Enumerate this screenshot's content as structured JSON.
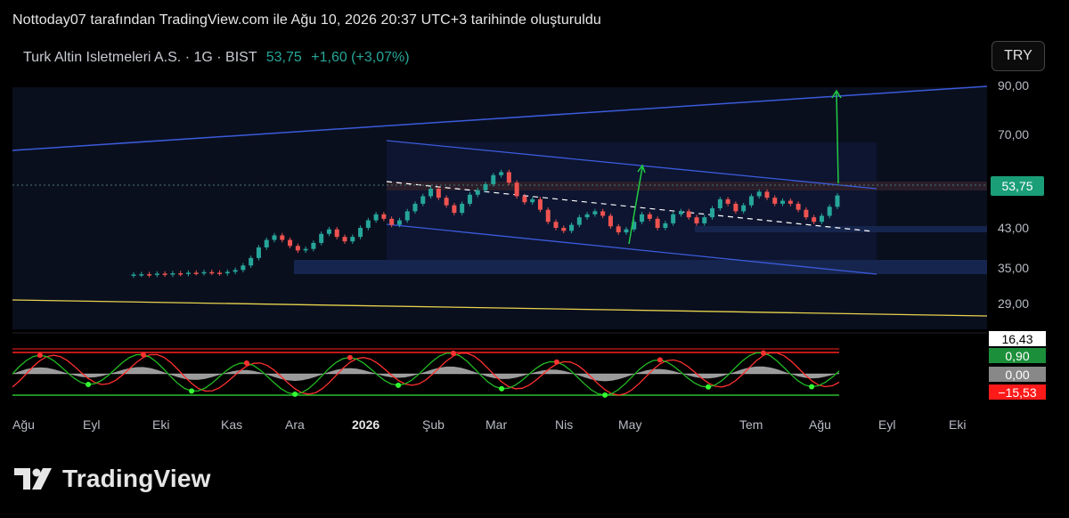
{
  "header": {
    "text": "Nottoday07 tarafından TradingView.com ile Ağu 10, 2026 20:37 UTC+3 tarihinde oluşturuldu"
  },
  "symbol": {
    "name": "Turk Altin Isletmeleri A.S. · 1G · BIST",
    "price": "53,75",
    "change": "+1,60 (+3,07%)"
  },
  "currency_button": "TRY",
  "brand": {
    "name": "TradingView"
  },
  "colors": {
    "up": "#26a69a",
    "down": "#ef5350",
    "channel": "#3b5bdb",
    "support": "#e8d44d",
    "arrow": "#22cc44"
  },
  "chart_data": {
    "type": "line",
    "title": "Turk Altin Isletmeleri A.S. · 1G · BIST",
    "last_price": 53.75,
    "y_tick_labels": [
      "90,00",
      "70,00",
      "43,00",
      "35,00",
      "29,00"
    ],
    "y_ticks": [
      90,
      70,
      43,
      35,
      29
    ],
    "price_label": "53,75",
    "x_tick_labels": [
      "Ağu",
      "Eyl",
      "Eki",
      "Kas",
      "Ara",
      "2026",
      "Şub",
      "Mar",
      "Nis",
      "May",
      "Tem",
      "Ağu",
      "Eyl",
      "Eki"
    ],
    "series": [
      {
        "values": [
          27.5,
          27.6,
          27.4,
          27.8,
          27.5,
          27.9,
          27.7,
          28.1,
          28.0,
          28.3,
          28.1,
          27.9,
          28.4,
          29.0,
          30.5,
          33.0,
          36.5,
          39.0,
          40.5,
          39.0,
          37.0,
          35.5,
          36.0,
          38.0,
          41.0,
          42.5,
          40.0,
          38.5,
          40.0,
          43.0,
          45.5,
          47.5,
          46.0,
          44.0,
          45.5,
          48.5,
          51.0,
          53.5,
          56.0,
          53.0,
          50.5,
          48.0,
          51.0,
          54.0,
          55.5,
          57.5,
          60.5,
          61.5,
          58.0,
          53.5,
          51.5,
          52.5,
          49.0,
          45.0,
          43.0,
          42.0,
          44.0,
          46.5,
          47.5,
          48.5,
          47.0,
          43.5,
          41.5,
          42.5,
          45.0,
          47.5,
          46.0,
          43.0,
          44.5,
          47.5,
          48.5,
          46.5,
          44.5,
          46.5,
          49.5,
          52.5,
          51.0,
          48.5,
          50.5,
          53.5,
          55.0,
          53.0,
          51.0,
          52.0,
          51.0,
          49.0,
          46.5,
          45.0,
          47.0,
          50.0,
          53.75
        ]
      }
    ],
    "oscillator": {
      "badges": [
        "16,43",
        "0,90",
        "0,00",
        "−15,53"
      ],
      "badge_colors": [
        "#ffffff",
        "#1b8f3a",
        "#888888",
        "#ff1a1a"
      ]
    },
    "annotations": [
      "large ascending channel",
      "descending inner channel",
      "two upward target arrows",
      "horizontal support bands"
    ]
  }
}
